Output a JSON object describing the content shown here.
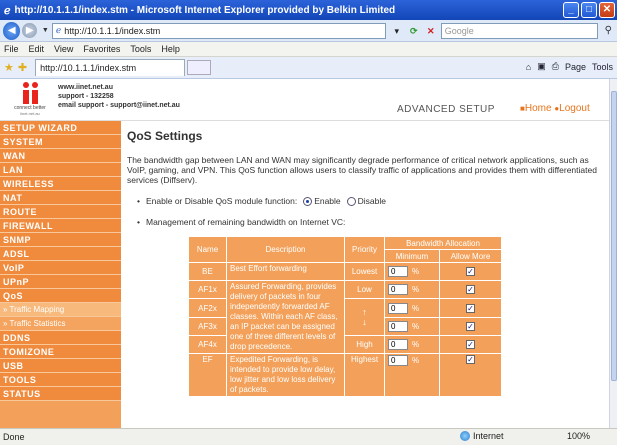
{
  "window": {
    "title": "http://10.1.1.1/index.stm - Microsoft Internet Explorer provided by Belkin Limited",
    "url": "http://10.1.1.1/index.stm",
    "search_placeholder": "Google",
    "tab_title": "http://10.1.1.1/index.stm",
    "menu": [
      "File",
      "Edit",
      "View",
      "Favorites",
      "Tools",
      "Help"
    ],
    "cmd_page": "Page",
    "cmd_tools": "Tools"
  },
  "header": {
    "logo_caption": "connect better",
    "logo_url": "iinet.net.au",
    "site": "www.iinet.net.au",
    "support_phone": "support - 132258",
    "support_email": "email support - support@iinet.net.au",
    "section": "ADVANCED SETUP",
    "home_link": "Home",
    "logout_link": "Logout"
  },
  "sidebar": {
    "items": [
      {
        "label": "SETUP WIZARD"
      },
      {
        "label": "SYSTEM"
      },
      {
        "label": "WAN"
      },
      {
        "label": "LAN"
      },
      {
        "label": "WIRELESS"
      },
      {
        "label": "NAT"
      },
      {
        "label": "ROUTE"
      },
      {
        "label": "FIREWALL"
      },
      {
        "label": "SNMP"
      },
      {
        "label": "ADSL"
      },
      {
        "label": "VoIP"
      },
      {
        "label": "UPnP"
      },
      {
        "label": "QoS"
      }
    ],
    "sub_items": [
      {
        "label": "» Traffic Mapping"
      },
      {
        "label": "» Traffic Statistics"
      }
    ],
    "items_after": [
      {
        "label": "DDNS"
      },
      {
        "label": "TOMIZONE"
      },
      {
        "label": "USB"
      },
      {
        "label": "TOOLS"
      },
      {
        "label": "STATUS"
      }
    ]
  },
  "main": {
    "title": "QoS Settings",
    "description": "The bandwidth gap between LAN and WAN may significantly degrade performance of critical network applications, such as VoIP, gaming, and VPN. This QoS function allows users to classify traffic of applications and provides them with differentiated services (Diffserv).",
    "enable_label": "Enable or Disable QoS module function:",
    "enable_option": "Enable",
    "disable_option": "Disable",
    "enable_selected": "Enable",
    "management_label": "Management of remaining bandwidth on Internet VC:",
    "table": {
      "headers": {
        "name": "Name",
        "description": "Description",
        "priority": "Priority",
        "bandwidth": "Bandwidth Allocation",
        "minimum": "Minimum",
        "allow_more": "Allow More"
      },
      "rows": [
        {
          "name": "BE",
          "min": "0",
          "allow_more": true
        },
        {
          "name": "AF1x",
          "min": "0",
          "allow_more": true
        },
        {
          "name": "AF2x",
          "min": "0",
          "allow_more": true
        },
        {
          "name": "AF3x",
          "min": "0",
          "allow_more": true
        },
        {
          "name": "AF4x",
          "min": "0",
          "allow_more": true
        },
        {
          "name": "EF",
          "min": "0",
          "allow_more": true
        }
      ],
      "be_desc": "Best Effort forwarding",
      "be_priority": "Lowest",
      "af_desc": "Assured Forwarding, provides delivery of packets in four independently forwarded AF classes. Within each AF class, an IP packet can be assigned one of three different levels of drop precedence.",
      "af_priority_low": "Low",
      "af_priority_high": "High",
      "ef_desc": "Expedited Forwarding, is intended to provide low delay, low jitter and low loss delivery of packets.",
      "ef_priority": "Highest",
      "percent": "%"
    }
  },
  "status": {
    "left": "Done",
    "zone": "Internet",
    "zoom": "100%"
  }
}
